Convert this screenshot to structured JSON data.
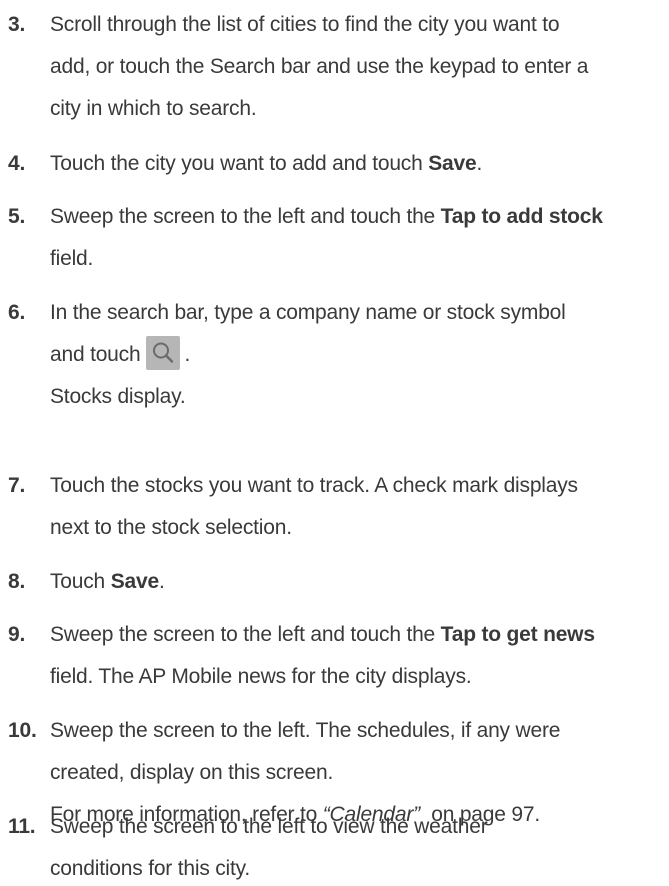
{
  "steps": [
    {
      "num": "3.",
      "lines": [
        "Scroll through the list of cities to find the city you want to",
        "add, or touch the Search bar and use the keypad to enter a",
        "city in which to search."
      ]
    },
    {
      "num": "4.",
      "pre": "Touch the city you want to add and touch ",
      "bold": "Save",
      "post": "."
    },
    {
      "num": "5.",
      "pre": "Sweep the screen to the left and touch the ",
      "bold": "Tap to add stock",
      "line2": "field."
    },
    {
      "num": "6.",
      "line1": "In the search bar, type a company name or stock symbol",
      "line2_pre": "and touch",
      "line2_post": ".",
      "line3": "Stocks display."
    },
    {
      "num": "7.",
      "line1": "Touch the stocks you want to track. A check mark displays",
      "line2": "next to the stock selection."
    },
    {
      "num": "8.",
      "pre": "Touch ",
      "bold": "Save",
      "post": "."
    },
    {
      "num": "9.",
      "pre": "Sweep the screen to the left and touch the ",
      "bold": "Tap to get news",
      "line2": "field. The AP Mobile news for the city displays."
    },
    {
      "num": "10.",
      "line1": "Sweep the screen to the left. The schedules, if any were",
      "line2": "created, display on this screen.",
      "line3_pre": "For more information, refer to ",
      "line3_ref": "“Calendar”",
      "line3_post": "  on page 97."
    },
    {
      "num": "11.",
      "line1": "Sweep the screen to the left to view the weather",
      "line2": "conditions for this city."
    }
  ],
  "icons": {
    "search": "search-icon"
  },
  "colors": {
    "text": "#3a3a3a",
    "icon_bg": "#b6b6b6"
  }
}
